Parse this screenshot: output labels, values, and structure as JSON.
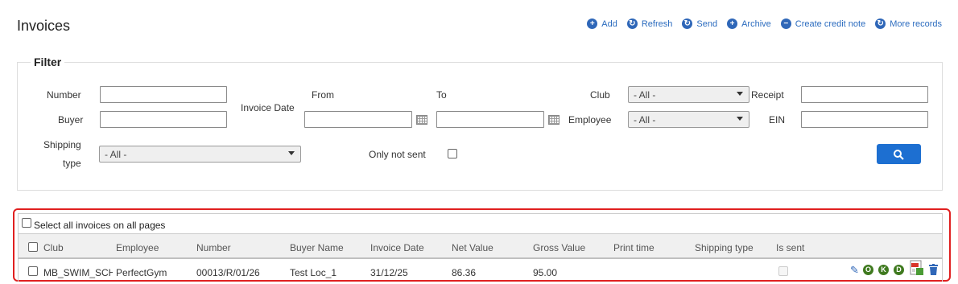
{
  "page_title": "Invoices",
  "actions": [
    {
      "label": "Add",
      "icon": "plus-icon",
      "glyph": "+"
    },
    {
      "label": "Refresh",
      "icon": "refresh-icon",
      "glyph": "↻"
    },
    {
      "label": "Send",
      "icon": "send-icon",
      "glyph": "↻"
    },
    {
      "label": "Archive",
      "icon": "plus-icon",
      "glyph": "+"
    },
    {
      "label": "Create credit note",
      "icon": "minus-icon",
      "glyph": "−"
    },
    {
      "label": "More records",
      "icon": "refresh-icon",
      "glyph": "↻"
    }
  ],
  "filter": {
    "legend": "Filter",
    "number_label": "Number",
    "buyer_label": "Buyer",
    "invoice_date_label": "Invoice Date",
    "from_label": "From",
    "to_label": "To",
    "club_label": "Club",
    "club_value": "- All -",
    "employee_label": "Employee",
    "employee_value": "- All -",
    "receipt_label": "Receipt",
    "ein_label": "EIN",
    "shipping_label_1": "Shipping",
    "shipping_label_2": "type",
    "shipping_value": "- All -",
    "only_not_sent_label": "Only not sent"
  },
  "grid": {
    "select_all_label": "Select all invoices on all pages",
    "columns": [
      "Club",
      "Employee",
      "Number",
      "Buyer Name",
      "Invoice Date",
      "Net Value",
      "Gross Value",
      "Print time",
      "Shipping type",
      "Is sent"
    ],
    "rows": [
      {
        "club": "MB_SWIM_SCHOOL",
        "employee": "PerfectGym",
        "number": "00013/R/01/26",
        "buyer": "Test Loc_1",
        "date": "31/12/25",
        "net": "86.36",
        "gross": "95.00",
        "print_time": "",
        "shipping": "",
        "is_sent": false
      }
    ],
    "row_icons": [
      {
        "name": "edit-icon",
        "glyph": "✎"
      },
      {
        "name": "o-badge-icon",
        "glyph": "O"
      },
      {
        "name": "k-badge-icon",
        "glyph": "K"
      },
      {
        "name": "d-badge-icon",
        "glyph": "D"
      },
      {
        "name": "pdf-document-icon",
        "glyph": ""
      },
      {
        "name": "delete-icon",
        "glyph": ""
      }
    ]
  },
  "colors": {
    "accent": "#2f67b8",
    "search_button": "#1d6fd1",
    "highlight_border": "#e02020",
    "badge_green": "#3f7a1f"
  }
}
